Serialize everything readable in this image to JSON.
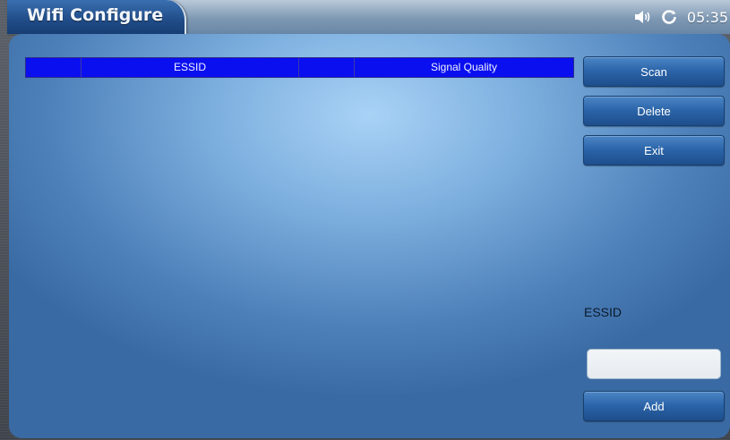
{
  "header": {
    "title": "Wifi Configure",
    "clock": "05:35",
    "icons": [
      "speaker-icon",
      "refresh-icon"
    ]
  },
  "table": {
    "columns": [
      "",
      "ESSID",
      "",
      "Signal Quality"
    ],
    "rows": []
  },
  "buttons": {
    "scan": "Scan",
    "delete": "Delete",
    "exit": "Exit",
    "add": "Add"
  },
  "form": {
    "essid_label": "ESSID",
    "essid_value": "",
    "essid_placeholder": ""
  },
  "colors": {
    "header_row": "#0a0ff0",
    "title_tab": "#204c88",
    "button": "#2a63a7",
    "panel": "#7eb0df"
  }
}
